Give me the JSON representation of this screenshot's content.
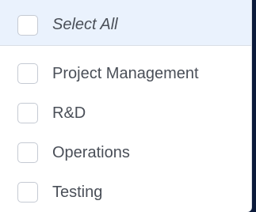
{
  "select_all": {
    "label": "Select All",
    "checked": false
  },
  "options": [
    {
      "label": "Project Management",
      "checked": false
    },
    {
      "label": "R&D",
      "checked": false
    },
    {
      "label": "Operations",
      "checked": false
    },
    {
      "label": "Testing",
      "checked": false
    }
  ],
  "colors": {
    "header_bg": "#eaf2fd",
    "text": "#4a4f58",
    "checkbox_border": "#c5cad3",
    "backdrop": "#0b1a3a"
  }
}
